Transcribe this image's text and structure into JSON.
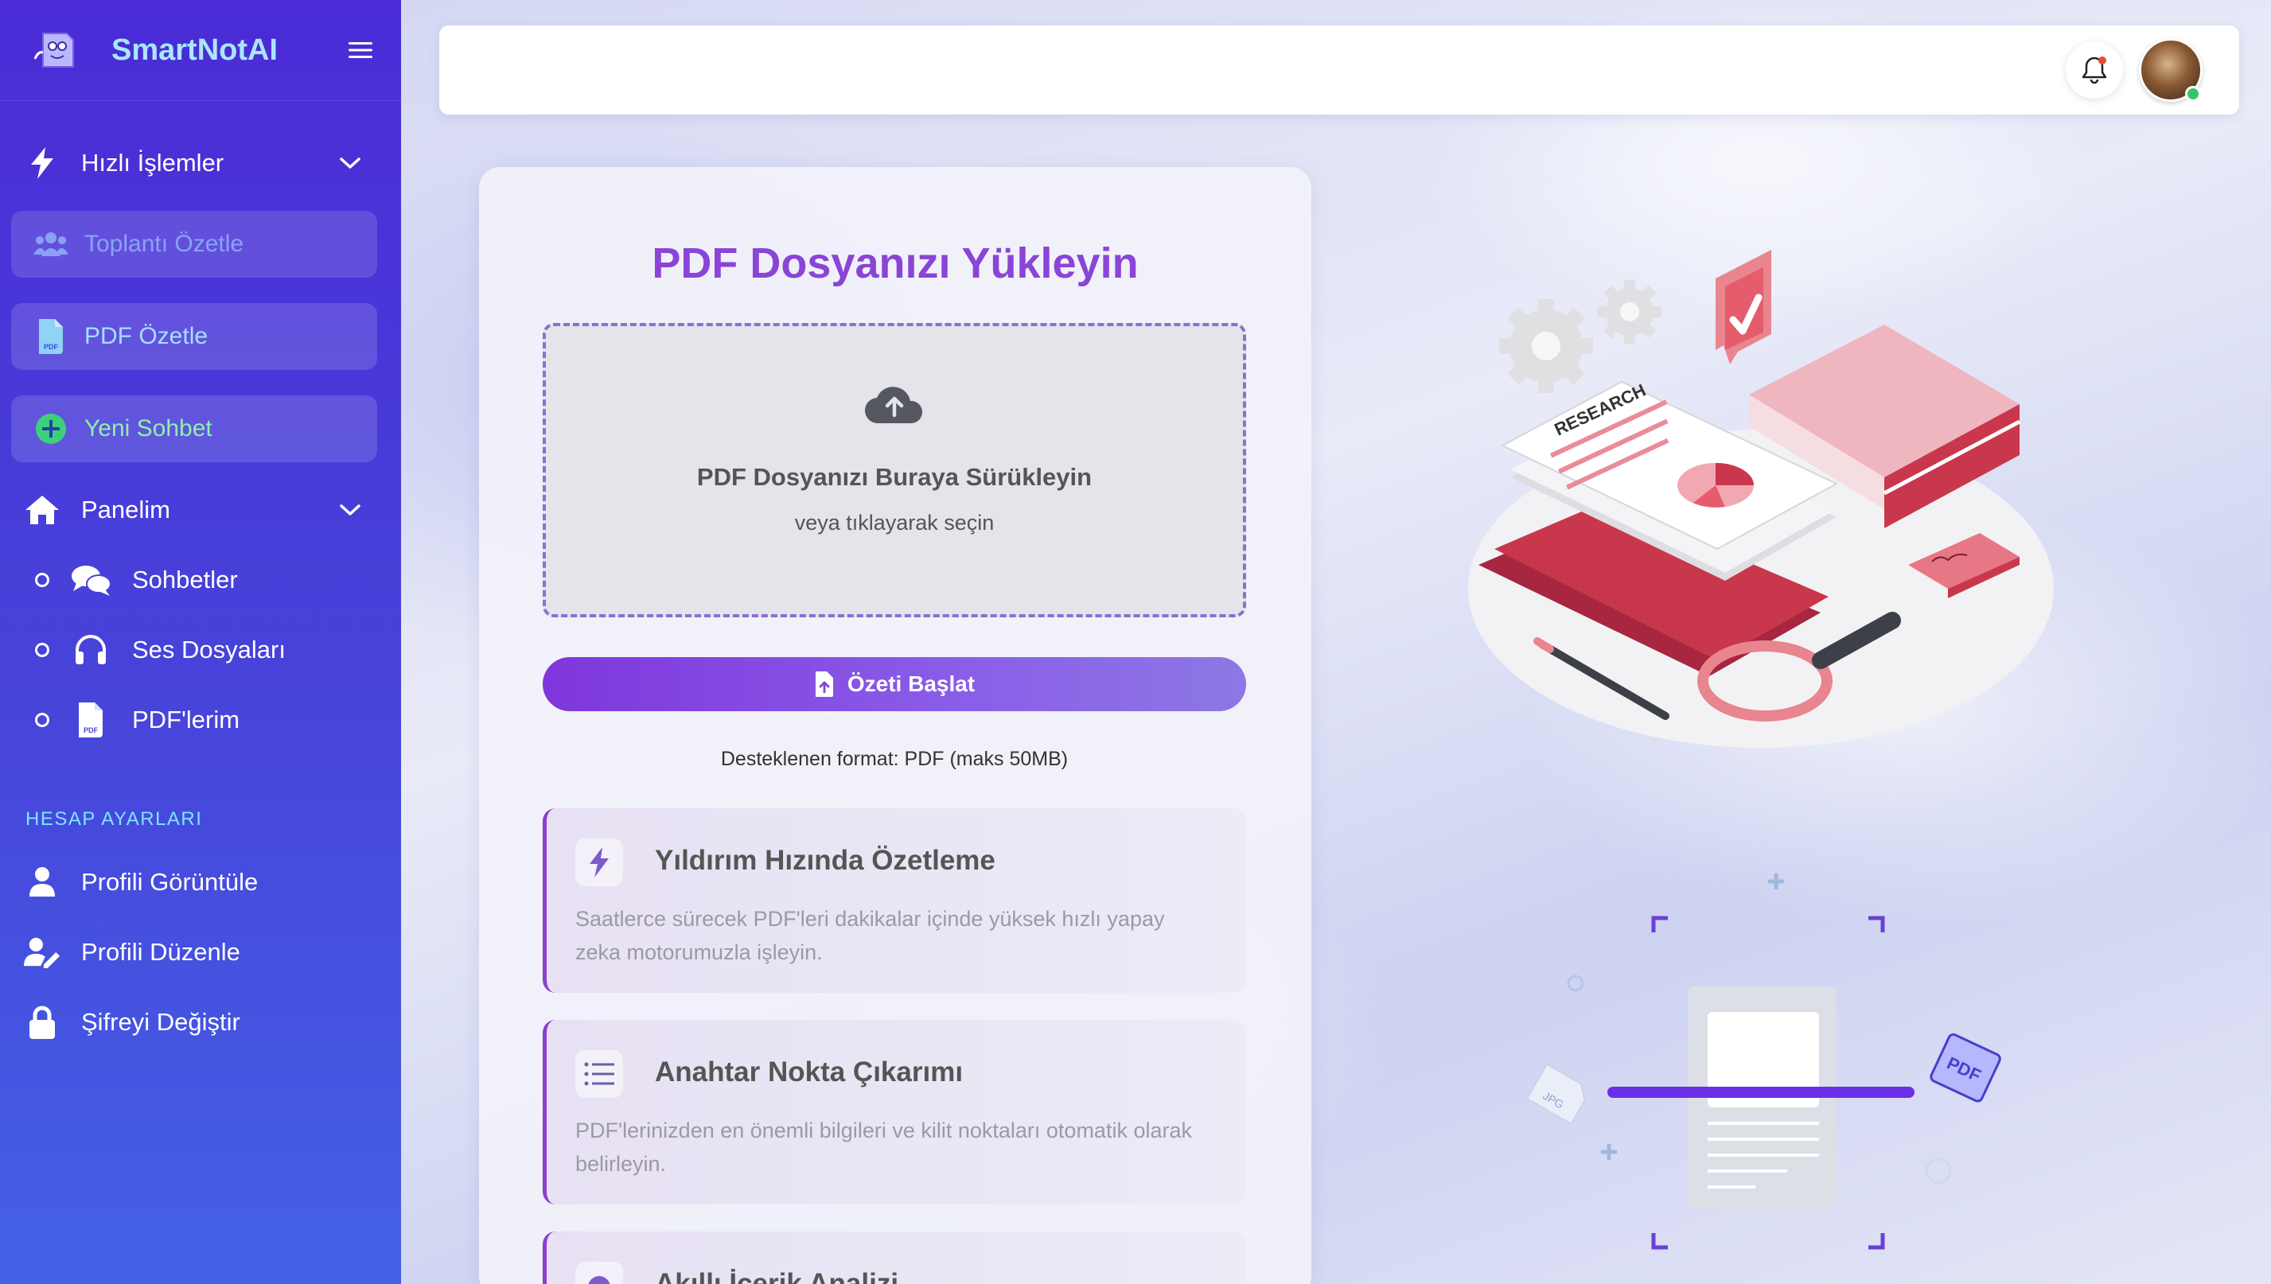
{
  "brand": {
    "name": "SmartNotAI"
  },
  "sidebar": {
    "quick_actions": {
      "label": "Hızlı İşlemler"
    },
    "pills": [
      {
        "label": "Toplantı Özetle"
      },
      {
        "label": "PDF Özetle"
      },
      {
        "label": "Yeni Sohbet"
      }
    ],
    "panel": {
      "label": "Panelim"
    },
    "panel_items": [
      {
        "label": "Sohbetler"
      },
      {
        "label": "Ses Dosyaları"
      },
      {
        "label": "PDF'lerim"
      }
    ],
    "account_title": "HESAP AYARLARI",
    "account_items": [
      {
        "label": "Profili Görüntüle"
      },
      {
        "label": "Profili Düzenle"
      },
      {
        "label": "Şifreyi Değiştir"
      }
    ]
  },
  "upload": {
    "title": "PDF Dosyanızı Yükleyin",
    "drop_title": "PDF Dosyanızı Buraya Sürükleyin",
    "drop_sub": "veya tıklayarak seçin",
    "button": "Özeti Başlat",
    "format_note": "Desteklenen format: PDF (maks 50MB)"
  },
  "features": [
    {
      "title": "Yıldırım Hızında Özetleme",
      "desc": "Saatlerce sürecek PDF'leri dakikalar içinde yüksek hızlı yapay zeka motorumuzla işleyin."
    },
    {
      "title": "Anahtar Nokta Çıkarımı",
      "desc": "PDF'lerinizden en önemli bilgileri ve kilit noktaları otomatik olarak belirleyin."
    },
    {
      "title": "Akıllı İçerik Analizi",
      "desc": ""
    }
  ],
  "illustration": {
    "research_label": "RESEARCH",
    "pdf_tag": "PDF",
    "jpg_tag": "JPG"
  },
  "colors": {
    "sidebar_start": "#4a2bd6",
    "sidebar_end": "#4361e6",
    "brand_text": "#a9e6ff",
    "accent_purple": "#8a44d6",
    "notification_dot": "#e74c3c",
    "online_status": "#35c46c"
  }
}
